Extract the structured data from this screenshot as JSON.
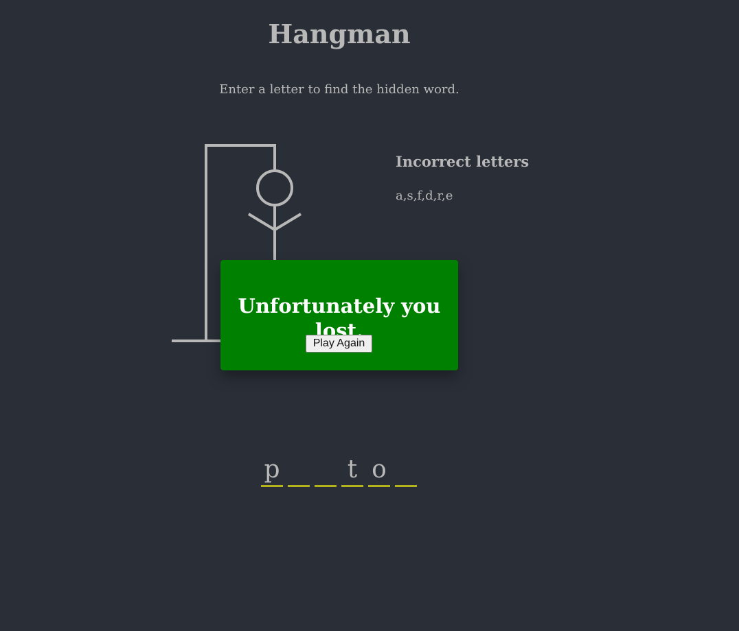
{
  "title": "Hangman",
  "instructions": "Enter a letter to find the hidden word.",
  "hangman_parts_shown": [
    "gallows",
    "head",
    "body",
    "arms"
  ],
  "wrong_letters": {
    "title": "Incorrect letters",
    "list": "a,s,f,d,r,e"
  },
  "word": [
    {
      "letter": "p"
    },
    {
      "letter": ""
    },
    {
      "letter": ""
    },
    {
      "letter": "t"
    },
    {
      "letter": "o"
    },
    {
      "letter": ""
    }
  ],
  "popup": {
    "message": "Unfortunately you lost.",
    "button_label": "Play Again"
  },
  "colors": {
    "background": "#2a2f37",
    "text": "#b8b8b8",
    "popup_background": "#008000",
    "letter_underline": "#b3b31d"
  }
}
